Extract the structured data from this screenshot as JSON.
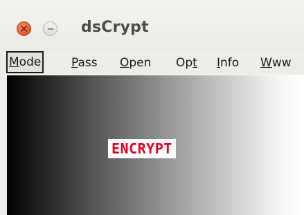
{
  "window": {
    "title": "dsCrypt"
  },
  "titlebar": {
    "close_icon": "close-icon",
    "minimize_icon": "minimize-icon",
    "accent_close": "#e65c2a"
  },
  "menu": {
    "items": [
      {
        "label": "Mode",
        "mnemonic": "M",
        "active": true
      },
      {
        "label": "Pass",
        "mnemonic": "P",
        "active": false
      },
      {
        "label": "Open",
        "mnemonic": "O",
        "active": false
      },
      {
        "label": "Opt",
        "mnemonic": "t",
        "active": false
      },
      {
        "label": "Info",
        "mnemonic": "I",
        "active": false
      },
      {
        "label": "Www",
        "mnemonic": "W",
        "active": false
      }
    ]
  },
  "main": {
    "mode_label": "ENCRYPT",
    "mode_label_color": "#e8001c"
  }
}
